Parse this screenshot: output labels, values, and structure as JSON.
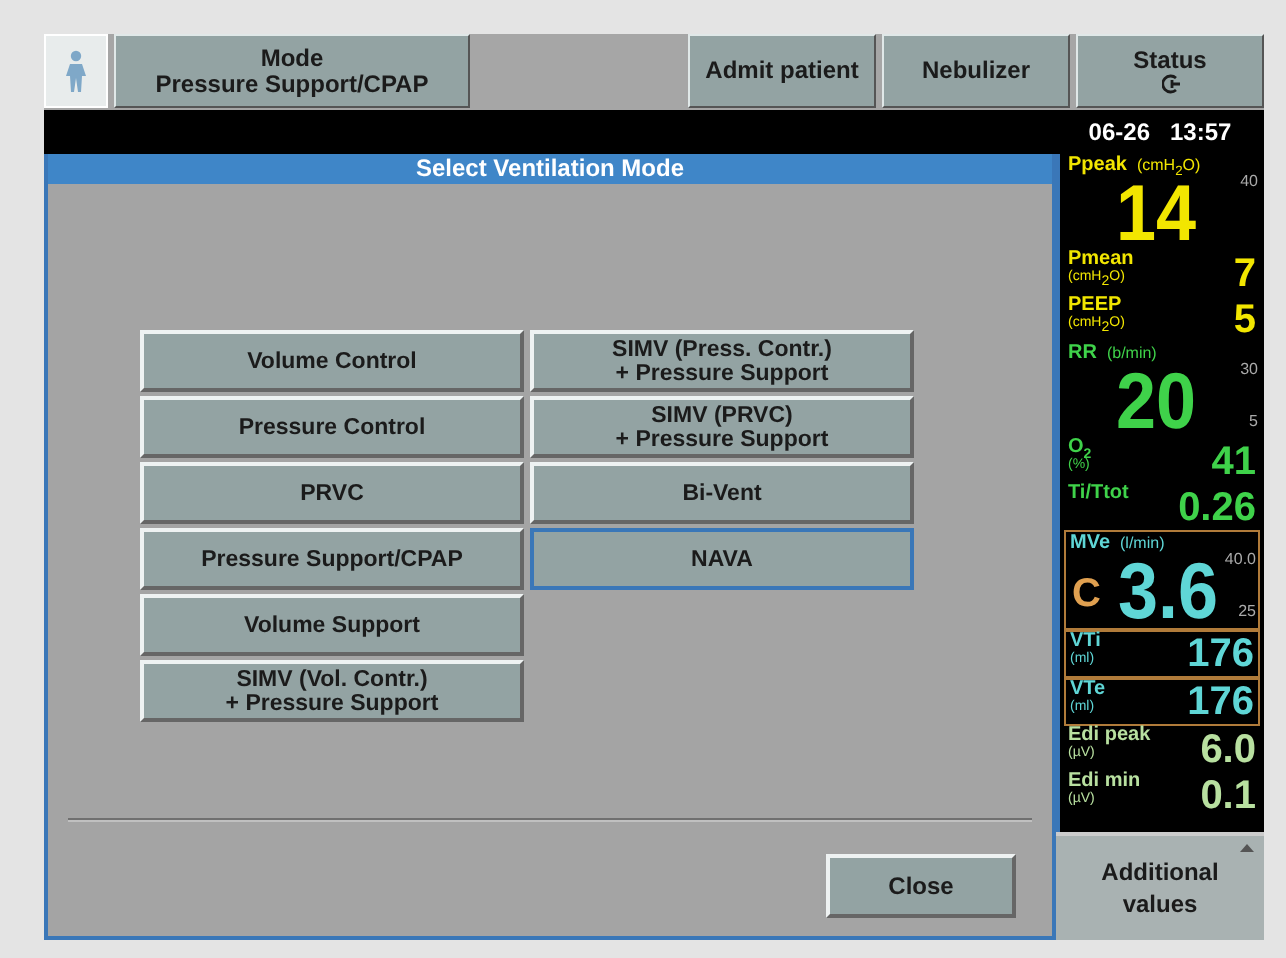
{
  "top_bar": {
    "mode_button": {
      "label": "Mode",
      "value": "Pressure Support/CPAP"
    },
    "buttons": [
      {
        "label": "Admit patient",
        "kind": "text"
      },
      {
        "label": "Nebulizer",
        "kind": "text"
      },
      {
        "label": "Status",
        "kind": "status"
      }
    ]
  },
  "clock": {
    "date": "06-26",
    "time": "13:57"
  },
  "dialog": {
    "title": "Select Ventilation Mode",
    "left_column": [
      {
        "label": "Volume Control",
        "selected": false
      },
      {
        "label": "Pressure Control",
        "selected": false
      },
      {
        "label": "PRVC",
        "selected": false
      },
      {
        "label": "Pressure Support/CPAP",
        "selected": false
      },
      {
        "label": "Volume Support",
        "selected": false
      },
      {
        "label": "SIMV (Vol. Contr.)\n+ Pressure Support",
        "selected": false
      }
    ],
    "right_column": [
      {
        "label": "SIMV (Press. Contr.)\n+ Pressure Support",
        "selected": false
      },
      {
        "label": "SIMV (PRVC)\n+ Pressure Support",
        "selected": false
      },
      {
        "label": "Bi-Vent",
        "selected": false
      },
      {
        "label": "NAVA",
        "selected": true
      }
    ],
    "close_button": "Close"
  },
  "measured_values": [
    {
      "kind": "big",
      "name": "Ppeak",
      "unit": "(cmH$_{2}$O)",
      "value": "14",
      "high": "40",
      "color": "#f2e600",
      "boxed": false
    },
    {
      "kind": "small",
      "name": "Pmean",
      "unit": "(cmH$_{2}$O)",
      "value": "7",
      "color": "#f2e600",
      "boxed": false
    },
    {
      "kind": "small",
      "name": "PEEP",
      "unit": "(cmH$_{2}$O)",
      "value": "5",
      "color": "#f2e600",
      "boxed": false
    },
    {
      "kind": "big",
      "name": "RR",
      "unit": "(b/min)",
      "value": "20",
      "high": "30",
      "low": "5",
      "color": "#3fd24a",
      "boxed": false
    },
    {
      "kind": "small",
      "name": "O$_{2}$",
      "unit": "(%)",
      "value": "41",
      "color": "#3fd24a",
      "boxed": false
    },
    {
      "kind": "small",
      "name": "Ti/Ttot",
      "value": "0.26",
      "color": "#3fd24a",
      "boxed": false
    },
    {
      "kind": "big",
      "name": "MVe",
      "unit": "(l/min)",
      "prefix": "C",
      "value": "3.6",
      "high": "40.0",
      "low": "25",
      "color": "#5fd6d6",
      "boxed": true
    },
    {
      "kind": "small",
      "name": "VTi",
      "unit": "(ml)",
      "value": "176",
      "color": "#5fd6d6",
      "boxed": true
    },
    {
      "kind": "small",
      "name": "VTe",
      "unit": "(ml)",
      "value": "176",
      "color": "#5fd6d6",
      "boxed": true
    },
    {
      "kind": "small",
      "name": "Edi peak",
      "unit": "(µV)",
      "value": "6.0",
      "color": "#b8e0a0",
      "boxed": false
    },
    {
      "kind": "small",
      "name": "Edi min",
      "unit": "(µV)",
      "value": "0.1",
      "color": "#b8e0a0",
      "boxed": false
    }
  ],
  "additional_values_button": "Additional values"
}
